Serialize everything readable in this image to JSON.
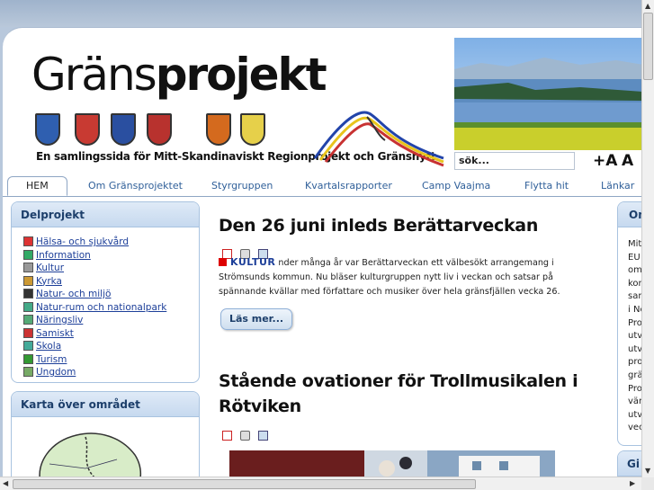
{
  "header": {
    "logo_part1": "Gräns",
    "logo_part2": "projekt",
    "tagline": "En samlingssida för Mitt-Skandinaviskt Regionprojekt och Gränsnytt",
    "search_placeholder": "sök...",
    "font_larger_label": "+A",
    "font_smaller_label": "A",
    "shield_colors": [
      "#2f5fb0",
      "#c83a32",
      "#2a4fa0",
      "#b8322e",
      "#d46a1e",
      "#e6d04a"
    ]
  },
  "nav": {
    "tabs": [
      {
        "label": "HEM",
        "active": true
      },
      {
        "label": "Om Gränsprojektet"
      },
      {
        "label": "Styrgruppen"
      },
      {
        "label": "Kvartalsrapporter"
      },
      {
        "label": "Camp Vaajma"
      },
      {
        "label": "Flytta hit"
      },
      {
        "label": "Länkar"
      }
    ]
  },
  "sidebar": {
    "delprojekt_title": "Delprojekt",
    "categories": [
      {
        "label": "Hälsa- och sjukvård",
        "icon": "health-icon",
        "color": "#d33"
      },
      {
        "label": "Information",
        "icon": "info-icon",
        "color": "#3a6"
      },
      {
        "label": "Kultur",
        "icon": "culture-icon",
        "color": "#999"
      },
      {
        "label": "Kyrka",
        "icon": "church-icon",
        "color": "#c93"
      },
      {
        "label": "Natur- och miljö",
        "icon": "nature-icon",
        "color": "#333"
      },
      {
        "label": "Natur-rum och nationalpark",
        "icon": "park-icon",
        "color": "#4a8"
      },
      {
        "label": "Näringsliv",
        "icon": "business-icon",
        "color": "#5a7"
      },
      {
        "label": "Samiskt",
        "icon": "sami-icon",
        "color": "#c33"
      },
      {
        "label": "Skola",
        "icon": "school-icon",
        "color": "#4a9"
      },
      {
        "label": "Turism",
        "icon": "tourism-icon",
        "color": "#393"
      },
      {
        "label": "Ungdom",
        "icon": "youth-icon",
        "color": "#7a6"
      }
    ],
    "map_title": "Karta över området"
  },
  "articles": [
    {
      "title": "Den 26 juni inleds Berättarveckan",
      "category": "KULTUR",
      "text": "nder många år var Berättarveckan ett välbesökt arrangemang i Strömsunds kommun. Nu bläser kulturgruppen nytt liv i veckan och satsar på spännande kvällar med författare och musiker över hela gränsfjällen vecka 26.",
      "read_more": "Läs mer..."
    },
    {
      "title_line1": "Stående ovationer för Trollmusikalen i",
      "title_line2": "Rötviken"
    }
  ],
  "right_column": {
    "box1_title": "Om",
    "box1_lines": [
      "Mitt",
      "EU",
      "om",
      "kon",
      "sam",
      "i No",
      "Pro",
      "utv",
      "utv",
      "pro",
      "grä",
      "Pro",
      "vär",
      "utv",
      "vec"
    ],
    "box2_title": "Gi"
  }
}
